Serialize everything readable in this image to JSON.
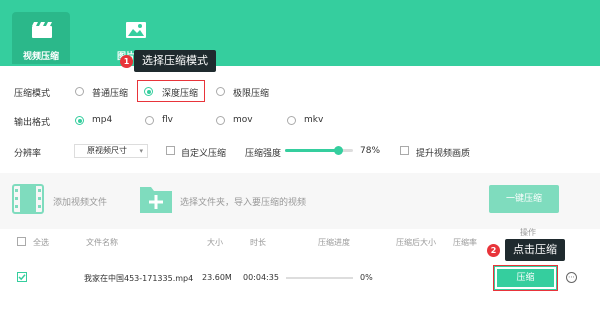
{
  "header": {
    "tabs": [
      {
        "label": "视频压缩",
        "icon": "clapperboard-icon",
        "active": true
      },
      {
        "label": "图片压缩",
        "icon": "image-icon",
        "active": false
      }
    ]
  },
  "tooltips": {
    "step1": {
      "badge": "1",
      "text": "选择压缩模式"
    },
    "step2": {
      "badge": "2",
      "text": "点击压缩"
    }
  },
  "settings": {
    "mode": {
      "label": "压缩模式",
      "options": [
        "普通压缩",
        "深度压缩",
        "极限压缩"
      ],
      "selected": "深度压缩"
    },
    "format": {
      "label": "输出格式",
      "options": [
        "mp4",
        "flv",
        "mov",
        "mkv"
      ],
      "selected": "mp4"
    },
    "resolution": {
      "label": "分辨率",
      "select_value": "原视频尺寸",
      "custom_label": "自定义压缩",
      "strength_label": "压缩强度",
      "strength_value": 78,
      "strength_text": "78%",
      "enhance_label": "提升视频画质"
    }
  },
  "toolbar": {
    "add_video": "添加视频文件",
    "add_folder": "选择文件夹，导入要压缩的视频",
    "one_click": "一键压缩"
  },
  "table": {
    "headers": {
      "select_all": "全选",
      "filename": "文件名称",
      "size": "大小",
      "duration": "时长",
      "progress": "压缩进度",
      "compressed_size": "压缩后大小",
      "ratio": "压缩率",
      "action": "操作"
    },
    "rows": [
      {
        "checked": true,
        "filename": "我家在中国453-171335.mp4",
        "size": "23.60M",
        "duration": "00:04:35",
        "progress": 0,
        "progress_text": "0%",
        "action_label": "压缩",
        "more": "⋯"
      }
    ]
  },
  "colors": {
    "accent": "#35ce9e",
    "highlight": "#e8343a",
    "tooltip_bg": "#1f2a2e"
  }
}
